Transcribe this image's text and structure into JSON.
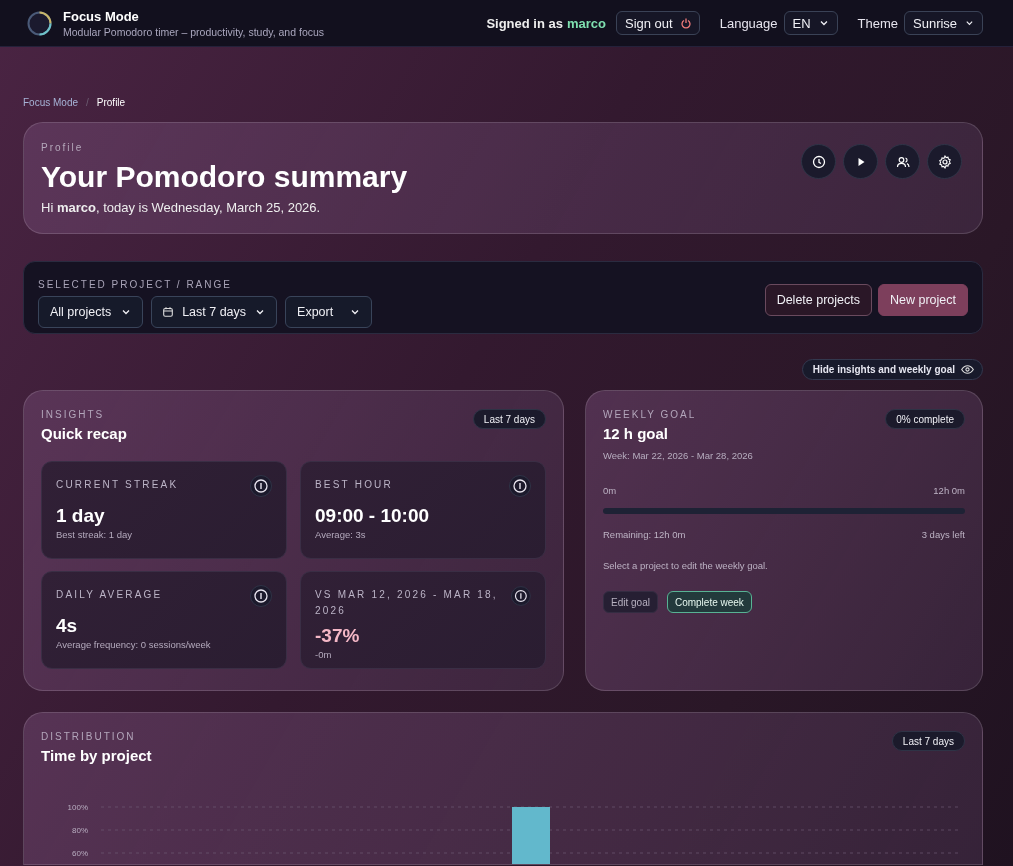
{
  "app": {
    "title": "Focus Mode",
    "subtitle": "Modular Pomodoro timer – productivity, study, and focus"
  },
  "account": {
    "signed_in_label": "Signed in as",
    "username": "marco",
    "sign_out": "Sign out"
  },
  "language": {
    "label": "Language",
    "value": "EN"
  },
  "theme": {
    "label": "Theme",
    "value": "Sunrise"
  },
  "breadcrumb_separator": "/",
  "breadcrumbs": [
    {
      "label": "Focus Mode",
      "current": false
    },
    {
      "label": "Profile",
      "current": true
    }
  ],
  "hero": {
    "eyebrow": "Profile",
    "title": "Your Pomodoro summary",
    "greeting": "Hi **marco**, today is Wednesday, March 25, 2026."
  },
  "filters": {
    "label": "SELECTED PROJECT / RANGE",
    "project": "All projects",
    "range": "Last 7 days",
    "export": "Export",
    "delete": "Delete projects",
    "new": "New project"
  },
  "toggle_insights": "Hide insights and weekly goal",
  "insights": {
    "eyebrow": "INSIGHTS",
    "title": "Quick recap",
    "badge": "Last 7 days",
    "stats": [
      {
        "label": "CURRENT STREAK",
        "value": "1 day",
        "note": "Best streak: 1 day",
        "kind": "plain"
      },
      {
        "label": "BEST HOUR",
        "value": "09:00 - 10:00",
        "note": "Average: 3s",
        "kind": "plain"
      },
      {
        "label": "DAILY AVERAGE",
        "value": "4s",
        "note": "Average frequency: 0 sessions/week",
        "kind": "plain"
      },
      {
        "label": "VS MAR 12, 2026 - MAR 18, 2026",
        "value": "-37%",
        "note": "-0m",
        "kind": "change"
      }
    ]
  },
  "weekly_goal": {
    "eyebrow": "WEEKLY GOAL",
    "title": "12 h goal",
    "week": "Week: Mar 22, 2026 - Mar 28, 2026",
    "badge": "0% complete",
    "scale_start": "0m",
    "scale_end": "12h 0m",
    "level": 0,
    "remaining": "Remaining: 12h 0m",
    "days_left": "3 days left",
    "hint": "Select a project to edit the weekly goal.",
    "buttons": [
      {
        "label": "Edit goal",
        "kind": "secondary"
      },
      {
        "label": "Complete week",
        "kind": "accent"
      }
    ]
  },
  "distribution": {
    "eyebrow": "DISTRIBUTION",
    "title": "Time by project",
    "badge": "Last 7 days",
    "chart_data": {
      "type": "bar",
      "values": [
        100
      ],
      "ylim": [
        0,
        100
      ],
      "yticks": [
        {
          "value": 60,
          "label": "60%"
        },
        {
          "value": 80,
          "label": "80%"
        },
        {
          "value": 100,
          "label": "100%"
        }
      ]
    }
  }
}
